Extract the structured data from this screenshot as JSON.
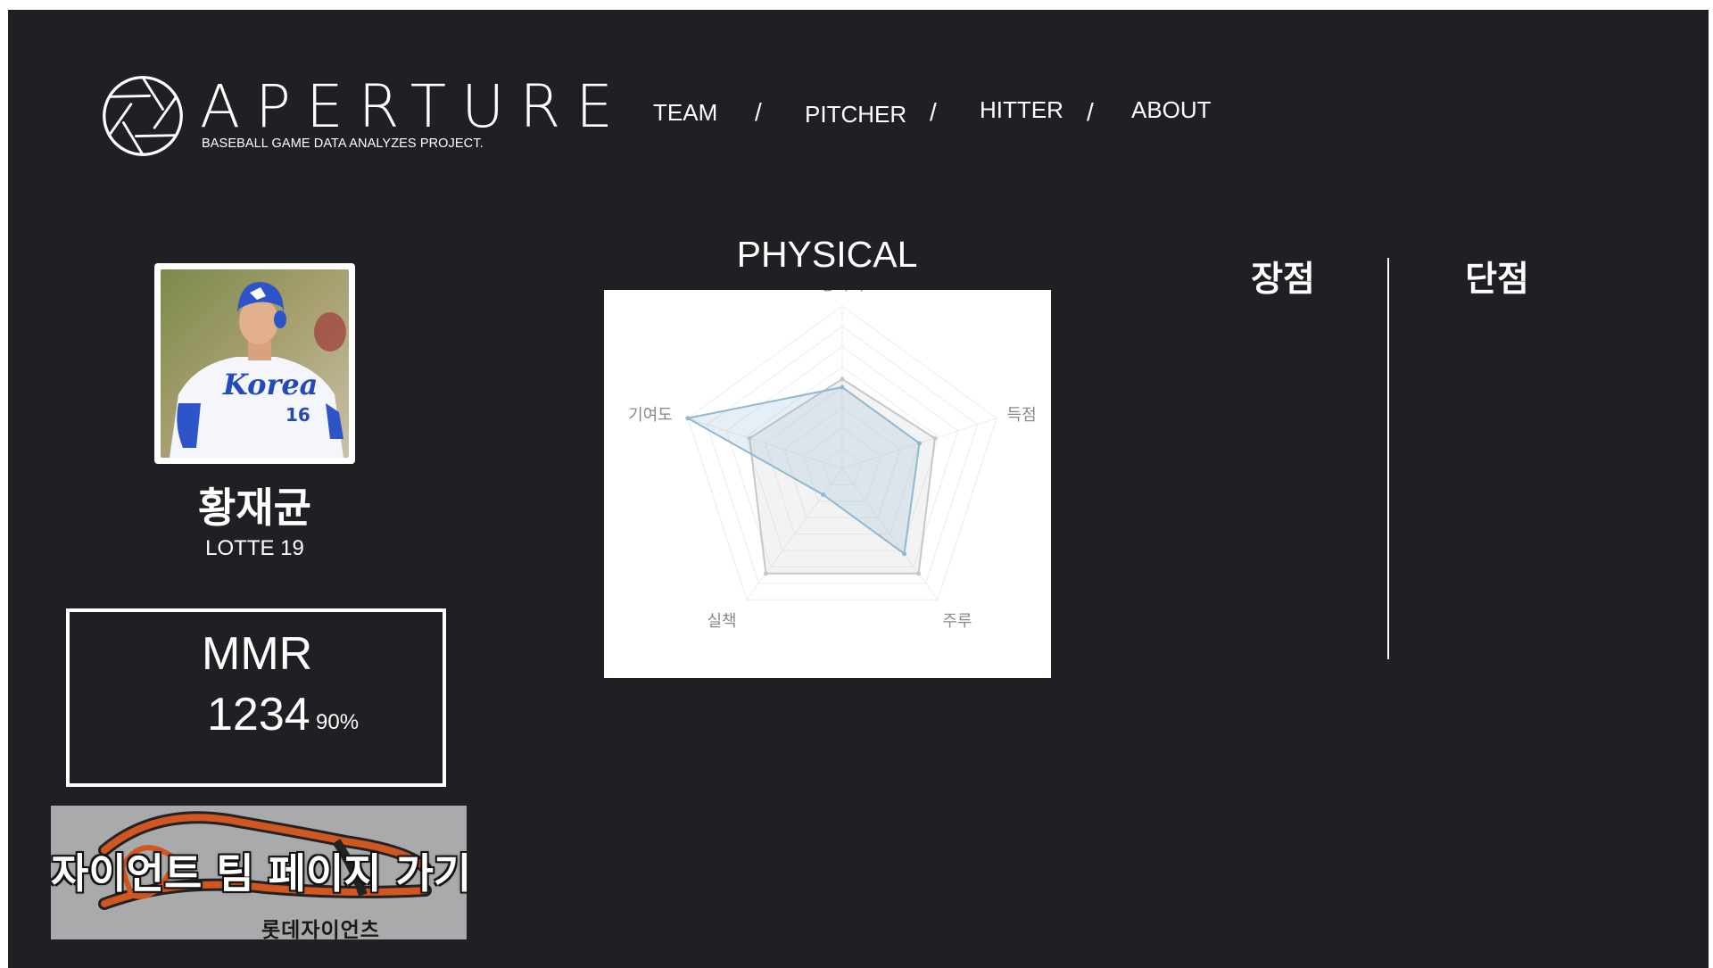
{
  "brand": {
    "name": "APERTURE",
    "tagline": "BASEBALL GAME DATA ANALYZES PROJECT."
  },
  "nav": {
    "items": [
      {
        "label": "TEAM"
      },
      {
        "label": "PITCHER"
      },
      {
        "label": "HITTER"
      },
      {
        "label": "ABOUT"
      }
    ],
    "separator": "/"
  },
  "player": {
    "name": "황재균",
    "team": "LOTTE 19",
    "photo_alt": "player photo"
  },
  "mmr": {
    "label": "MMR",
    "value": "1234",
    "percent": "90%"
  },
  "team_link": {
    "label": "자이언트 팀 페이지 가기",
    "sub_label": "롯데자이언츠"
  },
  "chart_data": {
    "type": "radar",
    "title": "PHYSICAL",
    "axes": [
      "장타력",
      "득점",
      "주루",
      "실책",
      "기여도"
    ],
    "range": [
      0,
      100
    ],
    "series": [
      {
        "values": [
          50,
          50,
          65,
          20,
          100
        ],
        "color": "#8fb8d1"
      },
      {
        "values": [
          55,
          60,
          80,
          80,
          60
        ],
        "color": "#c7c7c7"
      }
    ],
    "grid_levels": 8
  },
  "analysis": {
    "pros_label": "장점",
    "cons_label": "단점"
  },
  "colors": {
    "background": "#1f2023",
    "accent": "#8fb8d1"
  }
}
